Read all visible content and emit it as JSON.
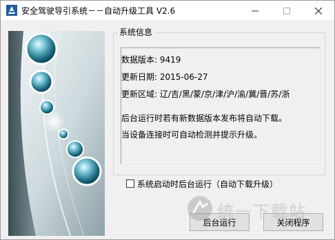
{
  "window": {
    "title": "安全驾驶导引系统－－自动升级工具 V2.6",
    "icon": "app-icon",
    "controls": {
      "minimize": "minimize-icon",
      "maximize": "maximize-icon",
      "close": "close-icon"
    }
  },
  "system_info": {
    "legend": "系统信息",
    "lines": [
      "数据版本: 9419",
      "更新日期: 2015-06-27",
      "更新区域: 辽/吉/黑/蒙/京/津/沪/渝/冀/晋/苏/浙",
      "后台运行时若有新数据版本发布将自动下载。",
      "当设备连接时可自动检测并提示升级。"
    ]
  },
  "options": {
    "background_autostart": {
      "label": "系统启动时后台运行（自动下载升级）",
      "checked": false
    }
  },
  "buttons": {
    "background_run": "后台运行",
    "close_program": "关闭程序"
  },
  "watermark": {
    "text": "统一下载站"
  },
  "colors": {
    "bubble": "#2f8fa7",
    "banner_bg": "#dfe8ea",
    "banner_dark": "#3f5a63"
  }
}
